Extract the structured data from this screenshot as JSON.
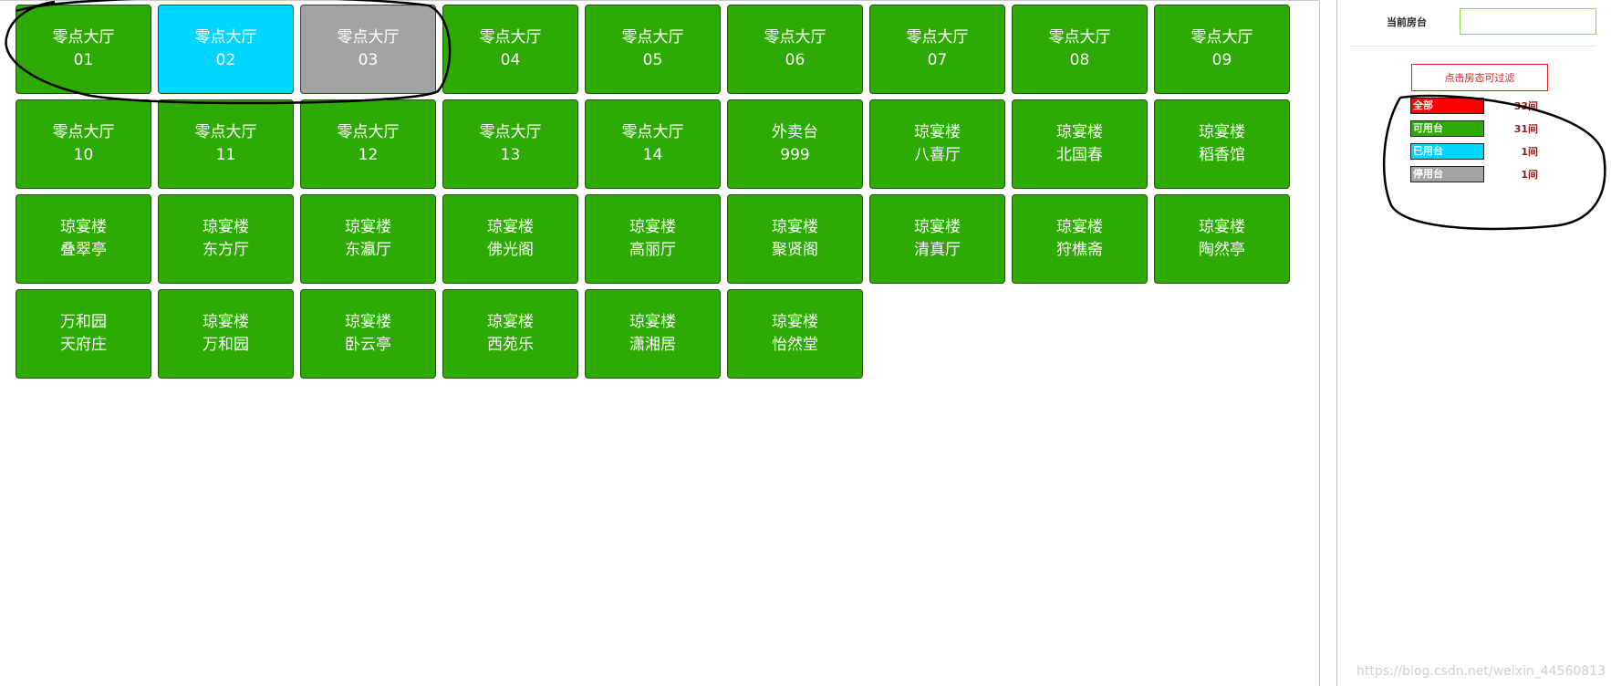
{
  "tables": [
    {
      "area": "零点大厅",
      "name": "01",
      "status": "available"
    },
    {
      "area": "零点大厅",
      "name": "02",
      "status": "used"
    },
    {
      "area": "零点大厅",
      "name": "03",
      "status": "disabled"
    },
    {
      "area": "零点大厅",
      "name": "04",
      "status": "available"
    },
    {
      "area": "零点大厅",
      "name": "05",
      "status": "available"
    },
    {
      "area": "零点大厅",
      "name": "06",
      "status": "available"
    },
    {
      "area": "零点大厅",
      "name": "07",
      "status": "available"
    },
    {
      "area": "零点大厅",
      "name": "08",
      "status": "available"
    },
    {
      "area": "零点大厅",
      "name": "09",
      "status": "available"
    },
    {
      "area": "零点大厅",
      "name": "10",
      "status": "available"
    },
    {
      "area": "零点大厅",
      "name": "11",
      "status": "available"
    },
    {
      "area": "零点大厅",
      "name": "12",
      "status": "available"
    },
    {
      "area": "零点大厅",
      "name": "13",
      "status": "available"
    },
    {
      "area": "零点大厅",
      "name": "14",
      "status": "available"
    },
    {
      "area": "外卖台",
      "name": "999",
      "status": "available"
    },
    {
      "area": "琼宴楼",
      "name": "八喜厅",
      "status": "available"
    },
    {
      "area": "琼宴楼",
      "name": "北国春",
      "status": "available"
    },
    {
      "area": "琼宴楼",
      "name": "稻香馆",
      "status": "available"
    },
    {
      "area": "琼宴楼",
      "name": "叠翠亭",
      "status": "available"
    },
    {
      "area": "琼宴楼",
      "name": "东方厅",
      "status": "available"
    },
    {
      "area": "琼宴楼",
      "name": "东瀛厅",
      "status": "available"
    },
    {
      "area": "琼宴楼",
      "name": "佛光阁",
      "status": "available"
    },
    {
      "area": "琼宴楼",
      "name": "高丽厅",
      "status": "available"
    },
    {
      "area": "琼宴楼",
      "name": "聚贤阁",
      "status": "available"
    },
    {
      "area": "琼宴楼",
      "name": "清真厅",
      "status": "available"
    },
    {
      "area": "琼宴楼",
      "name": "狩樵斋",
      "status": "available"
    },
    {
      "area": "琼宴楼",
      "name": "陶然亭",
      "status": "available"
    },
    {
      "area": "万和园",
      "name": "天府庄",
      "status": "available"
    },
    {
      "area": "琼宴楼",
      "name": "万和园",
      "status": "available"
    },
    {
      "area": "琼宴楼",
      "name": "卧云亭",
      "status": "available"
    },
    {
      "area": "琼宴楼",
      "name": "西苑乐",
      "status": "available"
    },
    {
      "area": "琼宴楼",
      "name": "潇湘居",
      "status": "available"
    },
    {
      "area": "琼宴楼",
      "name": "怡然堂",
      "status": "available"
    }
  ],
  "side": {
    "current_label": "当前房台",
    "current_value": "",
    "filter_hint": "点击房态可过滤",
    "legend": [
      {
        "label": "全部",
        "count": "33间",
        "color": "#ff0000"
      },
      {
        "label": "可用台",
        "count": "31间",
        "color": "#2eaa04"
      },
      {
        "label": "已用台",
        "count": "1间",
        "color": "#00d6ff"
      },
      {
        "label": "停用台",
        "count": "1间",
        "color": "#a3a3a3"
      }
    ]
  },
  "watermark": "https://blog.csdn.net/weixin_44560813"
}
